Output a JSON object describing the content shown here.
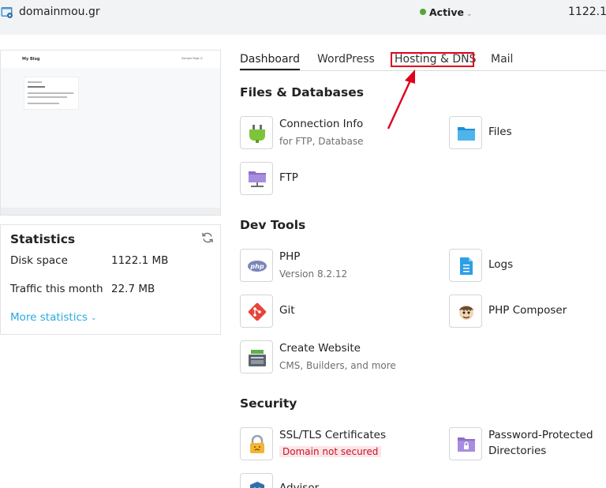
{
  "header": {
    "site_name": "domainmou.gr",
    "status": "Active",
    "disk_value": "1122.1"
  },
  "preview": {
    "blog_title": "My Blog",
    "menu_text": "Sample Page  Q"
  },
  "statistics": {
    "title": "Statistics",
    "rows": [
      {
        "label": "Disk space",
        "value": "1122.1 MB"
      },
      {
        "label": "Traffic this month",
        "value": "22.7 MB"
      }
    ],
    "more_label": "More statistics"
  },
  "tabs": [
    {
      "label": "Dashboard",
      "active": true
    },
    {
      "label": "WordPress",
      "active": false
    },
    {
      "label": "Hosting & DNS",
      "active": false
    },
    {
      "label": "Mail",
      "active": false
    }
  ],
  "sections": {
    "files": {
      "title": "Files & Databases",
      "connection_info": {
        "title": "Connection Info",
        "subtitle": "for FTP, Database"
      },
      "files": {
        "title": "Files"
      },
      "ftp": {
        "title": "FTP"
      }
    },
    "dev": {
      "title": "Dev Tools",
      "php": {
        "title": "PHP",
        "subtitle": "Version 8.2.12"
      },
      "logs": {
        "title": "Logs"
      },
      "git": {
        "title": "Git"
      },
      "composer": {
        "title": "PHP Composer"
      },
      "create_website": {
        "title": "Create Website",
        "subtitle": "CMS, Builders, and more"
      }
    },
    "security": {
      "title": "Security",
      "ssl": {
        "title": "SSL/TLS Certificates",
        "badge": "Domain not secured"
      },
      "password_dirs": {
        "title_line1": "Password-Protected",
        "title_line2": "Directories"
      },
      "advisor": {
        "title": "Advisor"
      }
    }
  },
  "annotation": {
    "highlight_color": "#e0001b"
  },
  "colors": {
    "accent": "#28aade",
    "active_dot": "#53a639",
    "warning": "#c5142b"
  }
}
